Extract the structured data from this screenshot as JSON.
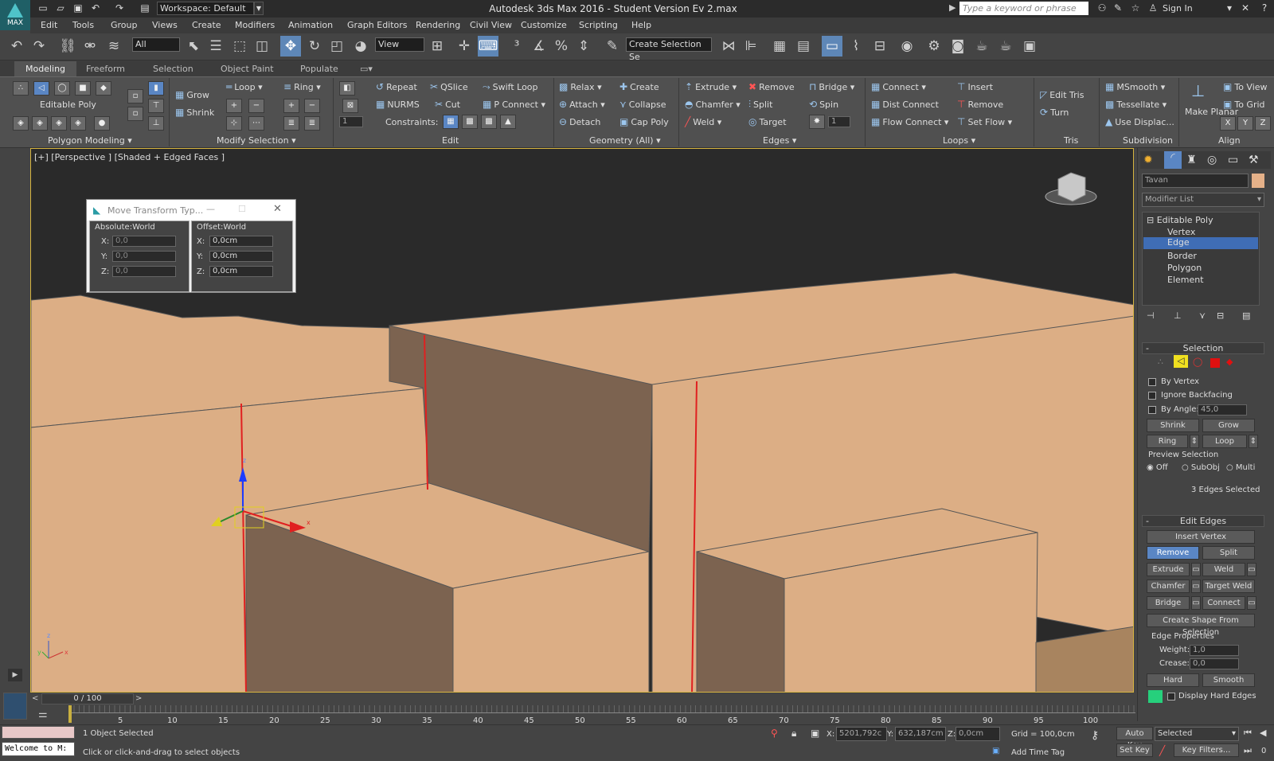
{
  "titlebar": {
    "workspace": "Workspace: Default",
    "title": "Autodesk 3ds Max 2016 - Student Version    Ev 2.max",
    "search_placeholder": "Type a keyword or phrase",
    "sign_in": "Sign In",
    "logo": "MAX"
  },
  "menu": [
    "Edit",
    "Tools",
    "Group",
    "Views",
    "Create",
    "Modifiers",
    "Animation",
    "Graph Editors",
    "Rendering",
    "Civil View",
    "Customize",
    "Scripting",
    "Help"
  ],
  "toolbar": {
    "filter": "All",
    "refcoord": "View",
    "selset": "Create Selection Se"
  },
  "ribbon_tabs": [
    "Modeling",
    "Freeform",
    "Selection",
    "Object Paint",
    "Populate"
  ],
  "ribbon": {
    "editable_poly": "Editable Poly",
    "grow": "Grow",
    "shrink": "Shrink",
    "loop": "Loop",
    "ring": "Ring",
    "repeat": "Repeat",
    "qslice": "QSlice",
    "swift_loop": "Swift Loop",
    "nurms": "NURMS",
    "cut": "Cut",
    "p_connect": "P Connect",
    "constraints": "Constraints:",
    "relax": "Relax",
    "create": "Create",
    "attach": "Attach",
    "collapse": "Collapse",
    "detach": "Detach",
    "cap_poly": "Cap Poly",
    "extrude": "Extrude",
    "remove": "Remove",
    "bridge": "Bridge",
    "chamfer": "Chamfer",
    "split": "Split",
    "spin": "Spin",
    "weld": "Weld",
    "target": "Target",
    "spin_val": "1",
    "connect": "Connect",
    "insert": "Insert",
    "dist_connect": "Dist Connect",
    "remove2": "Remove",
    "flow_connect": "Flow Connect",
    "set_flow": "Set Flow",
    "edit_tris": "Edit Tris",
    "turn": "Turn",
    "msmooth": "MSmooth",
    "tessellate": "Tessellate",
    "use_displac": "Use Displac...",
    "make_planar": "Make Planar",
    "to_view": "To View",
    "to_grid": "To Grid",
    "x": "X",
    "y": "Y",
    "z": "Z"
  },
  "panels": [
    "Polygon Modeling",
    "Modify Selection",
    "Edit",
    "Geometry (All)",
    "Edges",
    "Loops",
    "Tris",
    "Subdivision",
    "Align"
  ],
  "viewport": {
    "label": "[+] [Perspective ] [Shaded + Edged Faces ]"
  },
  "dialog": {
    "title": "Move Transform Typ...",
    "abs_group": "Absolute:World",
    "off_group": "Offset:World",
    "abs": [
      {
        "axis": "X:",
        "value": "0,0"
      },
      {
        "axis": "Y:",
        "value": "0,0"
      },
      {
        "axis": "Z:",
        "value": "0,0"
      }
    ],
    "off": [
      {
        "axis": "X:",
        "value": "0,0cm"
      },
      {
        "axis": "Y:",
        "value": "0,0cm"
      },
      {
        "axis": "Z:",
        "value": "0,0cm"
      }
    ]
  },
  "command": {
    "object_name": "Tavan",
    "modifier_list": "Modifier List",
    "stack": [
      "Editable Poly",
      "Vertex",
      "Edge",
      "Border",
      "Polygon",
      "Element"
    ],
    "selection_head": "Selection",
    "by_vertex": "By Vertex",
    "ignore_backfacing": "Ignore Backfacing",
    "by_angle": "By Angle:",
    "angle_val": "45,0",
    "shrink": "Shrink",
    "grow": "Grow",
    "ring": "Ring",
    "loop": "Loop",
    "preview": "Preview Selection",
    "off": "Off",
    "subobj": "SubObj",
    "multi": "Multi",
    "edges_selected": "3 Edges Selected",
    "edit_edges_head": "Edit Edges",
    "insert_vertex": "Insert Vertex",
    "remove": "Remove",
    "split": "Split",
    "extrude": "Extrude",
    "weld": "Weld",
    "chamfer": "Chamfer",
    "target_weld": "Target Weld",
    "bridge": "Bridge",
    "connect": "Connect",
    "create_shape": "Create Shape From Selection",
    "edge_props": "Edge Properties",
    "weight": "Weight:",
    "weight_val": "1,0",
    "crease": "Crease:",
    "crease_val": "0,0",
    "hard": "Hard",
    "smooth": "Smooth",
    "display_hard": "Display Hard Edges"
  },
  "timeline": {
    "slider": "0 / 100",
    "ticks": [
      "5",
      "10",
      "15",
      "20",
      "25",
      "30",
      "35",
      "40",
      "45",
      "50",
      "55",
      "60",
      "65",
      "70",
      "75",
      "80",
      "85",
      "90",
      "95",
      "100"
    ]
  },
  "status": {
    "welcome": "Welcome to M:",
    "selected": "1 Object Selected",
    "prompt": "Click or click-and-drag to select objects",
    "x": "X:",
    "x_val": "5201,792c",
    "y": "Y:",
    "y_val": "632,187cm",
    "z": "Z:",
    "z_val": "0,0cm",
    "grid": "Grid = 100,0cm",
    "add_time_tag": "Add Time Tag",
    "auto_key": "Auto Key",
    "set_key": "Set Key",
    "selected_drop": "Selected",
    "key_filters": "Key Filters..."
  },
  "colors": {
    "accent": "#5a86c4",
    "viewport_border": "#d6b440",
    "wall_light": "#dcae85",
    "wall_dark": "#7c6350",
    "edge_sel": "#e02020"
  }
}
